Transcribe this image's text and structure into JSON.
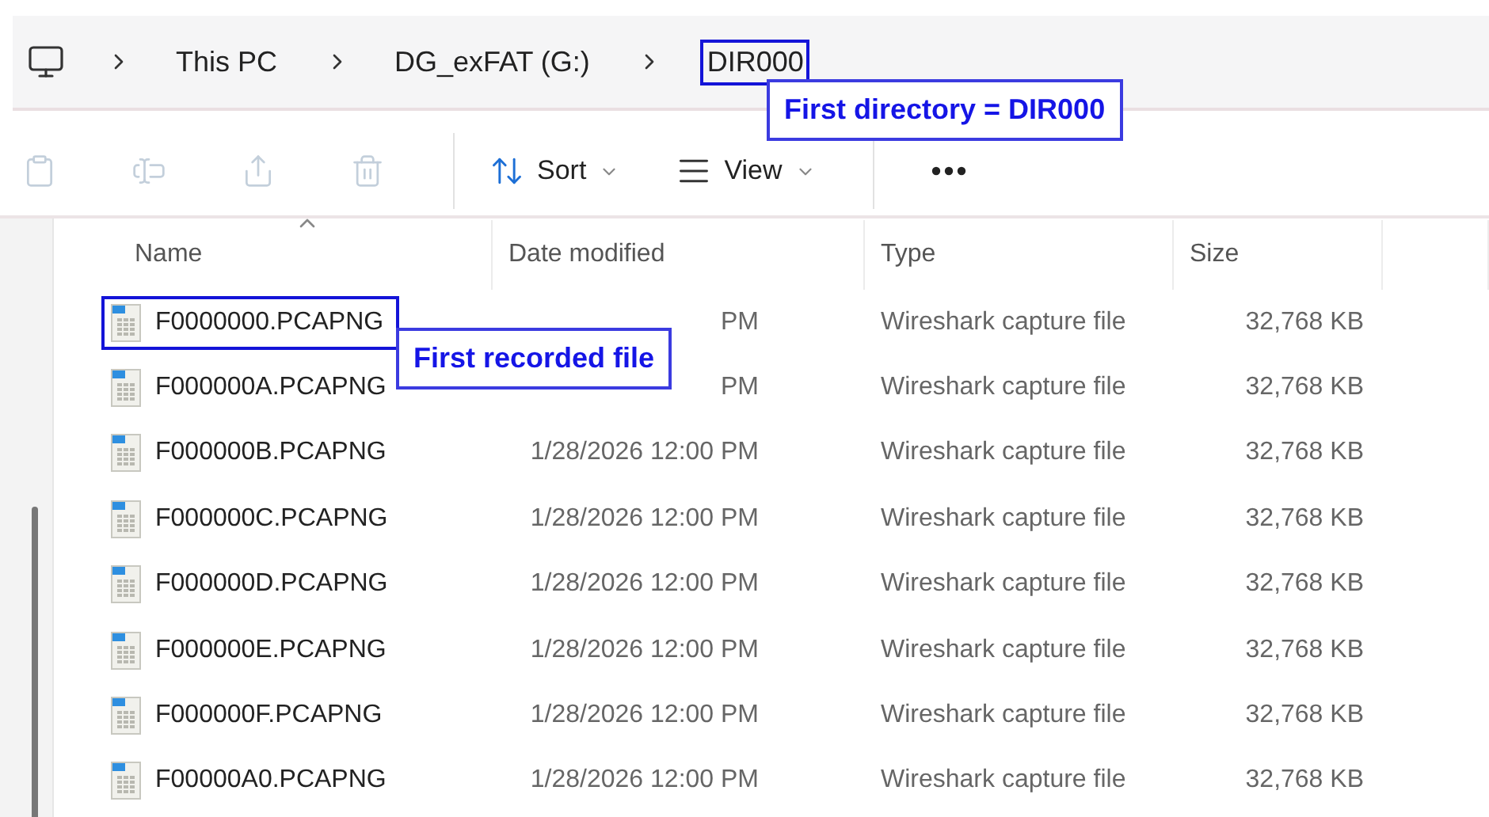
{
  "breadcrumb": {
    "items": [
      {
        "label": "This PC",
        "highlighted": false
      },
      {
        "label": "DG_exFAT (G:)",
        "highlighted": false
      },
      {
        "label": "DIR000",
        "highlighted": true
      }
    ]
  },
  "toolbar": {
    "buttons": [
      {
        "kind": "icon",
        "disabled": true
      },
      {
        "kind": "icon",
        "disabled": true
      },
      {
        "kind": "icon",
        "disabled": true
      },
      {
        "kind": "icon",
        "disabled": true
      },
      {
        "kind": "divider"
      },
      {
        "kind": "menu",
        "label": "Sort",
        "disabled": false
      },
      {
        "kind": "menu",
        "label": "View",
        "disabled": false
      },
      {
        "kind": "divider"
      },
      {
        "kind": "more"
      }
    ]
  },
  "table": {
    "columns": [
      {
        "label": "Name",
        "sorted": true
      },
      {
        "label": "Date modified",
        "sorted": false
      },
      {
        "label": "Type",
        "sorted": false
      },
      {
        "label": "Size",
        "sorted": false
      }
    ],
    "rows": [
      {
        "name": "F0000000.PCAPNG",
        "date": "PM",
        "type": "Wireshark capture file",
        "size": "32,768 KB",
        "highlighted": true
      },
      {
        "name": "F000000A.PCAPNG",
        "date": "PM",
        "type": "Wireshark capture file",
        "size": "32,768 KB",
        "highlighted": false
      },
      {
        "name": "F000000B.PCAPNG",
        "date": "1/28/2026 12:00 PM",
        "type": "Wireshark capture file",
        "size": "32,768 KB",
        "highlighted": false
      },
      {
        "name": "F000000C.PCAPNG",
        "date": "1/28/2026 12:00 PM",
        "type": "Wireshark capture file",
        "size": "32,768 KB",
        "highlighted": false
      },
      {
        "name": "F000000D.PCAPNG",
        "date": "1/28/2026 12:00 PM",
        "type": "Wireshark capture file",
        "size": "32,768 KB",
        "highlighted": false
      },
      {
        "name": "F000000E.PCAPNG",
        "date": "1/28/2026 12:00 PM",
        "type": "Wireshark capture file",
        "size": "32,768 KB",
        "highlighted": false
      },
      {
        "name": "F000000F.PCAPNG",
        "date": "1/28/2026 12:00 PM",
        "type": "Wireshark capture file",
        "size": "32,768 KB",
        "highlighted": false
      },
      {
        "name": "F00000A0.PCAPNG",
        "date": "1/28/2026 12:00 PM",
        "type": "Wireshark capture file",
        "size": "32,768 KB",
        "highlighted": false
      }
    ]
  },
  "annotations": [
    {
      "text": "First directory = DIR000"
    },
    {
      "text": "First recorded file"
    }
  ]
}
